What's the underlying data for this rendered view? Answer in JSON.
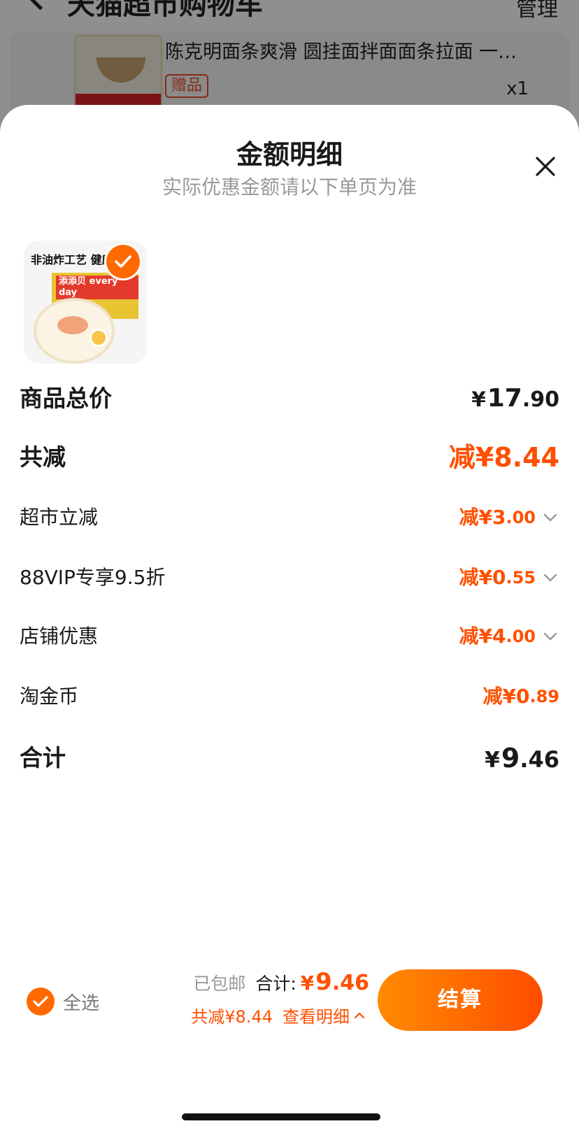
{
  "background": {
    "title": "天猫超市购物车",
    "more_label": "管理",
    "item_name": "陈克明面条爽滑 圆挂面拌面面条拉面 一…",
    "item_tag": "赠品",
    "item_qty": "x1"
  },
  "sheet": {
    "title": "金额明细",
    "subtitle": "实际优惠金额请以下单页为准"
  },
  "product": {
    "banner": "非油炸工艺 健康",
    "brand": "添添贝 every day"
  },
  "rows": {
    "total_price": {
      "label": "商品总价",
      "yen": "¥",
      "int": "17",
      "dec": ".90"
    },
    "total_discount": {
      "label": "共减",
      "prefix": "减¥",
      "int": "8",
      "dec": ".44"
    },
    "supermarket": {
      "label": "超市立减",
      "prefix": "减¥",
      "int": "3",
      "dec": ".00"
    },
    "vip": {
      "label": "88VIP专享9.5折",
      "prefix": "减¥",
      "int": "0",
      "dec": ".55"
    },
    "store": {
      "label": "店铺优惠",
      "prefix": "减¥",
      "int": "4",
      "dec": ".00"
    },
    "coins": {
      "label": "淘金币",
      "prefix": "减¥",
      "int": "0",
      "dec": ".89"
    },
    "subtotal": {
      "label": "合计",
      "yen": "¥",
      "int": "9",
      "dec": ".46"
    }
  },
  "footer": {
    "select_all": "全选",
    "shipping": "已包邮",
    "sum_label": "合计:",
    "sum_yen": "¥",
    "sum_int": "9",
    "sum_dec": ".46",
    "saved": "共减¥8.44",
    "detail_link": "查看明细",
    "checkout": "结算"
  },
  "colors": {
    "accent": "#ff5000",
    "checkout_gradient_start": "#ff8c00",
    "checkout_gradient_end": "#ff4d00"
  }
}
